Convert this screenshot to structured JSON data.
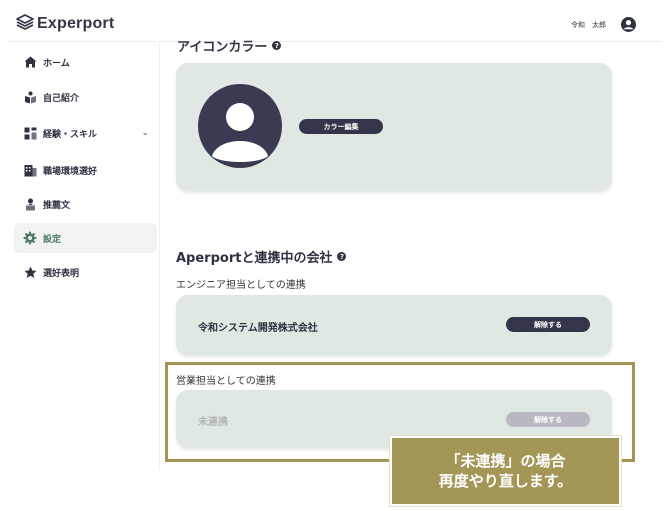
{
  "header": {
    "logo_text": "Experport",
    "user_name": "令和　太郎",
    "icons": {
      "logo": "layers-logo-icon",
      "user": "user-circle-icon"
    }
  },
  "sidebar": {
    "items": [
      {
        "label": "ホーム",
        "icon": "home-icon",
        "active": false
      },
      {
        "label": "自己紹介",
        "icon": "person-book-icon",
        "active": false
      },
      {
        "label": "経験・スキル",
        "icon": "grid-icon",
        "active": false,
        "expandable": true
      },
      {
        "label": "職場環境選好",
        "icon": "building-icon",
        "active": false
      },
      {
        "label": "推薦文",
        "icon": "recommend-icon",
        "active": false
      },
      {
        "label": "設定",
        "icon": "gear-icon",
        "active": true
      },
      {
        "label": "選好表明",
        "icon": "star-icon",
        "active": false
      }
    ]
  },
  "main": {
    "icon_color_section": {
      "title": "アイコンカラー",
      "edit_button": "カラー編集"
    },
    "linked_section": {
      "title": "Aperportと連携中の会社",
      "engineer": {
        "subtitle": "エンジニア担当としての連携",
        "company": "令和システム開発株式会社",
        "button": "解除する"
      },
      "sales": {
        "subtitle": "営業担当としての連携",
        "company": "未連携",
        "button": "解除する",
        "button_disabled": true
      }
    }
  },
  "annotation": {
    "line1": "「未連携」の場合",
    "line2": "再度やり直します。"
  },
  "colors": {
    "accent_dark": "#33364a",
    "card_bg": "#dfe8e2",
    "highlight": "#a39656",
    "active_item": "#4c7a62"
  }
}
